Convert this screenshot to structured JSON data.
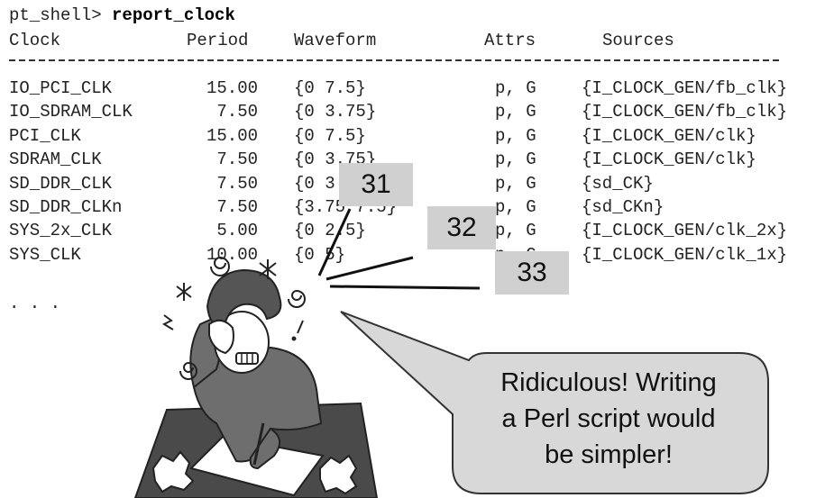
{
  "prompt": {
    "prefix": "pt_shell> ",
    "command": "report_clock"
  },
  "headers": {
    "clock": "Clock",
    "period": "Period",
    "waveform": "Waveform",
    "attrs": "Attrs",
    "sources": "Sources"
  },
  "rows": [
    {
      "clock": "IO_PCI_CLK",
      "period": "15.00",
      "waveform": "{0 7.5}",
      "attrs": "p, G",
      "sources": "{I_CLOCK_GEN/fb_clk}"
    },
    {
      "clock": "IO_SDRAM_CLK",
      "period": "7.50",
      "waveform": "{0 3.75}",
      "attrs": "p, G",
      "sources": "{I_CLOCK_GEN/fb_clk}"
    },
    {
      "clock": "PCI_CLK",
      "period": "15.00",
      "waveform": "{0 7.5}",
      "attrs": "p, G",
      "sources": "{I_CLOCK_GEN/clk}"
    },
    {
      "clock": "SDRAM_CLK",
      "period": "7.50",
      "waveform": "{0 3.75}",
      "attrs": "p, G",
      "sources": "{I_CLOCK_GEN/clk}"
    },
    {
      "clock": "SD_DDR_CLK",
      "period": "7.50",
      "waveform": "{0 3.75}",
      "attrs": "p, G",
      "sources": "{sd_CK}"
    },
    {
      "clock": "SD_DDR_CLKn",
      "period": "7.50",
      "waveform": "{3.75 7.5}",
      "attrs": "p, G",
      "sources": "{sd_CKn}"
    },
    {
      "clock": "SYS_2x_CLK",
      "period": "5.00",
      "waveform": "{0 2.5}",
      "attrs": "p, G",
      "sources": "{I_CLOCK_GEN/clk_2x}"
    },
    {
      "clock": "SYS_CLK",
      "period": "10.00",
      "waveform": "{0 5}",
      "attrs": "p, G",
      "sources": "{I_CLOCK_GEN/clk_1x}"
    }
  ],
  "ellipsis": ". . .",
  "callouts": {
    "c31": "31",
    "c32": "32",
    "c33": "33"
  },
  "speech_bubble": {
    "line1": "Ridiculous!  Writing",
    "line2": "a Perl script would",
    "line3": "be simpler!"
  },
  "colors": {
    "callout_bg": "#d0d0d0",
    "bubble_fill": "#d8d8d8",
    "desk_fill": "#4a4a4a",
    "sweater_fill": "#6e6e6e"
  }
}
